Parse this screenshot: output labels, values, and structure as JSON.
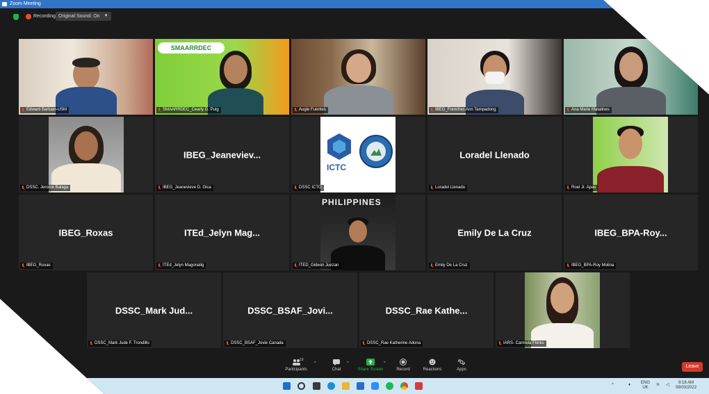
{
  "window": {
    "title": "Zoom Meeting"
  },
  "topbar": {
    "recording_label": "Recording",
    "original_sound_label": "Original Sound: On"
  },
  "tiles": [
    {
      "name": "Edward Barluan-USM",
      "big": ""
    },
    {
      "name": "SMAARRDEC_Cearly G. Puig",
      "big": ""
    },
    {
      "name": "Augie Fuentes",
      "big": ""
    },
    {
      "name": "IBEG_Frenches Ann Tampadong",
      "big": ""
    },
    {
      "name": "Ana Marie Matalines",
      "big": ""
    },
    {
      "name": "DSSC. Jerome Balaga",
      "big": ""
    },
    {
      "name": "IBEG_Jeanevieve D. Gica",
      "big": "IBEG_Jeaneviev..."
    },
    {
      "name": "DSSC ICTO",
      "big": ""
    },
    {
      "name": "Loradel Llenado",
      "big": "Loradel Llenado"
    },
    {
      "name": "Roel Jr. Apas",
      "big": ""
    },
    {
      "name": "IBEG_Roxas",
      "big": "IBEG_Roxas"
    },
    {
      "name": "ITEd_Jelyn Magonalig",
      "big": "ITEd_Jelyn  Mag..."
    },
    {
      "name": "ITED_Gideon Juezan",
      "big": ""
    },
    {
      "name": "Emily De La Cruz",
      "big": "Emily De La Cruz"
    },
    {
      "name": "IBEG_BPA-Roy Molina",
      "big": "IBEG_BPA-Roy..."
    },
    {
      "name": "DSSC_Mark Jude F. Trondillo",
      "big": "DSSC_Mark  Jud..."
    },
    {
      "name": "DSSC_BSAF_Jovie Canada",
      "big": "DSSC_BSAF_Jovi..."
    },
    {
      "name": "DSSC_Rae Katherine Adona",
      "big": "DSSC_Rae  Kathe..."
    },
    {
      "name": "IARS- Carmela Flores",
      "big": ""
    }
  ],
  "logos": {
    "smaarrdec": "SMAARRDEC",
    "ictc": "ICTC",
    "philippines": "PHILIPPINES"
  },
  "toolbar": {
    "participants_label": "Participants",
    "participants_count": "19",
    "chat_label": "Chat",
    "share_label": "Share Screen",
    "record_label": "Record",
    "reactions_label": "Reactions",
    "apps_label": "Apps",
    "leave_label": "Leave"
  },
  "taskbar": {
    "lang_1": "ENG",
    "lang_2": "UK",
    "time": "9:18 AM",
    "date": "08/03/2022"
  },
  "colors": {
    "active_speaker": "#a5d15a",
    "leave": "#d33a2e",
    "share": "#22b14c",
    "titlebar": "#2f75c8"
  }
}
